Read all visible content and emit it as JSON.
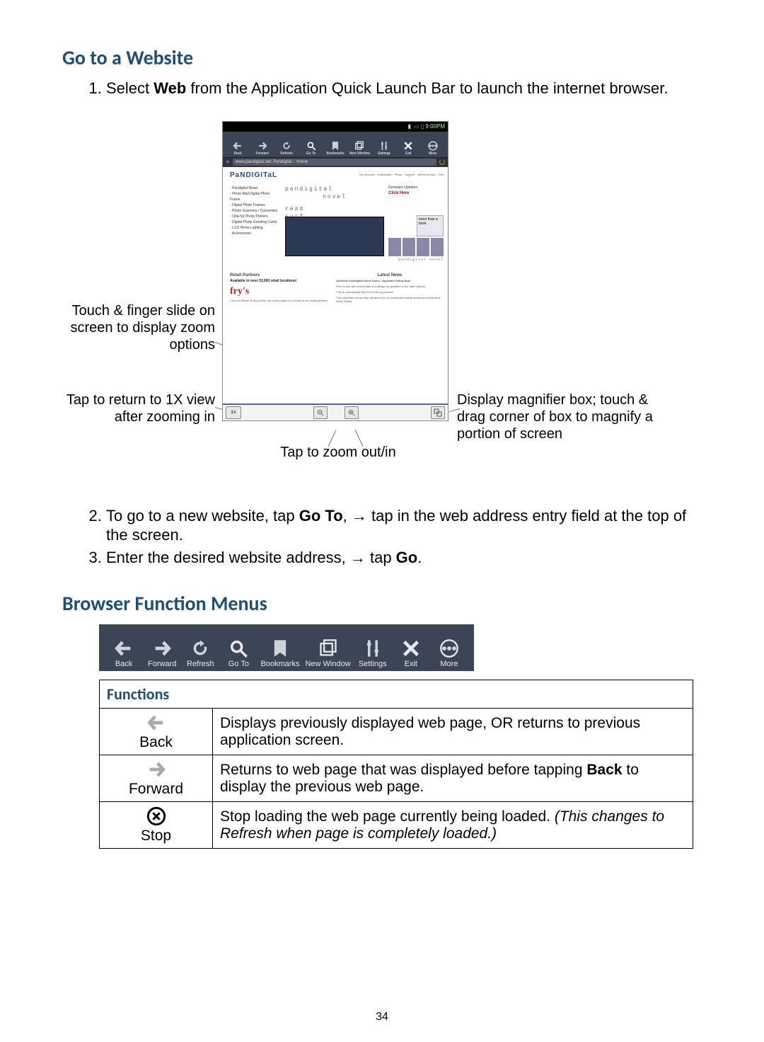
{
  "headings": {
    "go_to_website": "Go to a Website",
    "browser_menus": "Browser Function Menus"
  },
  "steps": {
    "s1_pre": "Select ",
    "s1_bold": "Web",
    "s1_post": " from the Application Quick Launch Bar to launch the internet browser.",
    "s2_pre": "To go to a new website, tap ",
    "s2_bold": "Go To",
    "s2_mid": ", → tap in the web address entry field at the top of the screen.",
    "s3_pre": "Enter the desired website address, → tap ",
    "s3_bold": "Go",
    "s3_post": "."
  },
  "callouts": {
    "touch_slide": "Touch & finger slide on screen to display zoom options",
    "return_1x": "Tap to return to 1X view after zooming in",
    "zoom_inout": "Tap to zoom out/in",
    "magnifier": "Display magnifier box; touch & drag corner of box to magnify a portion of screen"
  },
  "tablet": {
    "status_time": "9:00PM",
    "url": "www.pandigital.net: Pandigital :: Home",
    "logo": "PaNDIGITaL",
    "topnav": "My Account :: Downloads :: Press :: Support :: Where to Buy :: Cart",
    "left_items": [
      "Pandigital Novel",
      "Photo Mail Digital Photo Frame",
      "Digital Photo Frames",
      "Photo Scanners / Converters",
      "One-Str Photo Printers",
      "Digital Photo Greeting Cards",
      "LCD Home Lighting",
      "Accessories"
    ],
    "mid1": "pandigital",
    "mid2": "novel",
    "mid3": "read",
    "mid4": "surf",
    "click_here": "Click Here",
    "firmware": "Firmware Updates",
    "morebook": "more than a book",
    "pd_novel": "pandigital novel",
    "retail_h": "Retail Partners",
    "avail": "Available in over 33,000 retail locations!",
    "frys": "fry's",
    "frys_sub": "Click on Where To Buy at the top of the page for a full list of our retail partners.",
    "latest_h": "Latest News",
    "latest_hl": "Attention Pandigital Novel Users: Important Setup Note",
    "latest_p1": "Prior to use the current date in Settings as specified in the user manual.",
    "latest_p2": "This is a necessary step in the set-up process.",
    "latest_p3": "This important set-up step will allow you to quickly and easily access your Barnes & Noble library.",
    "onex": "1x"
  },
  "toolbar": {
    "items": [
      {
        "icon": "back",
        "label": "Back"
      },
      {
        "icon": "forward",
        "label": "Forward"
      },
      {
        "icon": "refresh",
        "label": "Refresh"
      },
      {
        "icon": "goto",
        "label": "Go To"
      },
      {
        "icon": "bookmarks",
        "label": "Bookmarks"
      },
      {
        "icon": "newwindow",
        "label": "New Window"
      },
      {
        "icon": "settings",
        "label": "Settings"
      },
      {
        "icon": "exit",
        "label": "Exit"
      },
      {
        "icon": "more",
        "label": "More"
      }
    ]
  },
  "table": {
    "header": "Functions",
    "rows": [
      {
        "icon": "back",
        "label": "Back",
        "desc_pre": "Displays previously displayed web page, OR returns to previous application screen.",
        "bold": "",
        "desc_post": ""
      },
      {
        "icon": "forward",
        "label": "Forward",
        "desc_pre": "Returns to web page that was displayed before tapping ",
        "bold": "Back",
        "desc_post": " to display the previous web page."
      },
      {
        "icon": "stop",
        "label": "Stop",
        "desc_pre": "Stop loading the web page currently being loaded. ",
        "italic": "(This changes to Refresh when page is completely loaded.)"
      }
    ]
  },
  "page_number": "34"
}
